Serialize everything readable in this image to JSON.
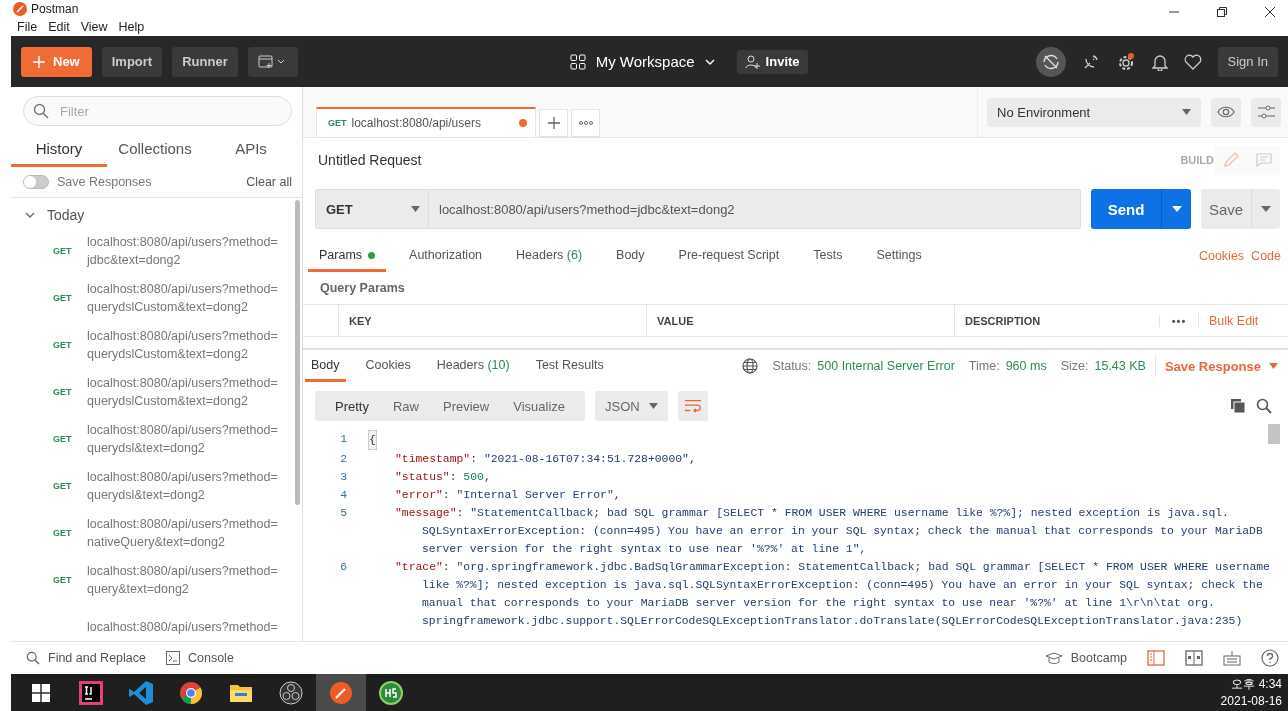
{
  "window": {
    "title": "Postman"
  },
  "menu": [
    "File",
    "Edit",
    "View",
    "Help"
  ],
  "toolbar": {
    "new": "New",
    "import": "Import",
    "runner": "Runner",
    "workspace": "My Workspace",
    "invite": "Invite",
    "sign_in": "Sign In",
    "sync_off": true,
    "settings_badge": true
  },
  "sidebar": {
    "filter_placeholder": "Filter",
    "tabs": [
      {
        "label": "History",
        "selected": true
      },
      {
        "label": "Collections",
        "selected": false
      },
      {
        "label": "APIs",
        "selected": false
      }
    ],
    "save_responses": {
      "label": "Save Responses",
      "on": false
    },
    "clear_all": "Clear all",
    "group": {
      "label": "Today",
      "expanded": true
    },
    "items": [
      {
        "method": "GET",
        "url": "localhost:8080/api/users?method=",
        "url2": "jdbc&text=dong2"
      },
      {
        "method": "GET",
        "url": "localhost:8080/api/users?method=",
        "url2": "querydslCustom&text=dong2"
      },
      {
        "method": "GET",
        "url": "localhost:8080/api/users?method=",
        "url2": "querydslCustom&text=dong2"
      },
      {
        "method": "GET",
        "url": "localhost:8080/api/users?method=",
        "url2": "querydslCustom&text=dong2"
      },
      {
        "method": "GET",
        "url": "localhost:8080/api/users?method=",
        "url2": "querydsl&text=dong2"
      },
      {
        "method": "GET",
        "url": "localhost:8080/api/users?method=",
        "url2": "querydsl&text=dong2"
      },
      {
        "method": "GET",
        "url": "localhost:8080/api/users?method=",
        "url2": "nativeQuery&text=dong2"
      },
      {
        "method": "GET",
        "url": "localhost:8080/api/users?method=",
        "url2": "query&text=dong2"
      },
      {
        "url": "localhost:8080/api/users?method="
      }
    ]
  },
  "request_tabs": [
    {
      "method": "GET",
      "label": "localhost:8080/api/users",
      "unsaved": true,
      "selected": true
    }
  ],
  "environment": "No Environment",
  "request": {
    "title": "Untitled Request",
    "mode": "BUILD",
    "method": "GET",
    "url": "localhost:8080/api/users?method=jdbc&text=dong2",
    "send": "Send",
    "save": "Save"
  },
  "request_sections": [
    {
      "label": "Params",
      "selected": true,
      "dot": true
    },
    {
      "label": "Authorization",
      "selected": false
    },
    {
      "label": "Headers",
      "count": "(6)",
      "selected": false
    },
    {
      "label": "Body",
      "selected": false
    },
    {
      "label": "Pre-request Script",
      "selected": false
    },
    {
      "label": "Tests",
      "selected": false
    },
    {
      "label": "Settings",
      "selected": false
    }
  ],
  "request_links": [
    "Cookies",
    "Code"
  ],
  "query_params": {
    "title": "Query Params",
    "columns": [
      "KEY",
      "VALUE",
      "DESCRIPTION"
    ],
    "more": "•••",
    "bulk_edit": "Bulk Edit"
  },
  "response_tabs": [
    {
      "label": "Body",
      "selected": true
    },
    {
      "label": "Cookies",
      "selected": false
    },
    {
      "label": "Headers",
      "count": "(10)",
      "selected": false
    },
    {
      "label": "Test Results",
      "selected": false
    }
  ],
  "response_meta": {
    "status_label": "Status:",
    "status": "500 Internal Server Error",
    "time_label": "Time:",
    "time": "960 ms",
    "size_label": "Size:",
    "size": "15.43 KB",
    "save_response": "Save Response"
  },
  "view_modes": [
    {
      "label": "Pretty",
      "selected": true
    },
    {
      "label": "Raw",
      "selected": false
    },
    {
      "label": "Preview",
      "selected": false
    },
    {
      "label": "Visualize",
      "selected": false
    }
  ],
  "format": "JSON",
  "wrap_on": true,
  "code": [
    {
      "num": "1",
      "parts": [
        {
          "kind": "punct",
          "text": "{"
        }
      ]
    },
    {
      "num": "2",
      "parts": [
        {
          "kind": "key",
          "text": "\"timestamp\""
        },
        {
          "kind": "punct",
          "text": ": "
        },
        {
          "kind": "string",
          "text": "\"2021-08-16T07:34:51.728+0000\""
        },
        {
          "kind": "punct",
          "text": ","
        }
      ]
    },
    {
      "num": "3",
      "parts": [
        {
          "kind": "key",
          "text": "\"status\""
        },
        {
          "kind": "punct",
          "text": ": "
        },
        {
          "kind": "number",
          "text": "500"
        },
        {
          "kind": "punct",
          "text": ","
        }
      ]
    },
    {
      "num": "4",
      "parts": [
        {
          "kind": "key",
          "text": "\"error\""
        },
        {
          "kind": "punct",
          "text": ": "
        },
        {
          "kind": "string",
          "text": "\"Internal Server Error\""
        },
        {
          "kind": "punct",
          "text": ","
        }
      ]
    },
    {
      "num": "5",
      "parts": [
        {
          "kind": "key",
          "text": "\"message\""
        },
        {
          "kind": "punct",
          "text": ": "
        },
        {
          "kind": "string",
          "text": "\"StatementCallback; bad SQL grammar [SELECT * FROM USER WHERE username like %?%]; nested exception is java.sql."
        }
      ],
      "more": [
        "SQLSyntaxErrorException: (conn=495) You have an error in your SQL syntax; check the manual that corresponds to your MariaDB",
        "server version for the right syntax to use near '%?%' at line 1\","
      ]
    },
    {
      "num": "6",
      "parts": [
        {
          "kind": "key",
          "text": "\"trace\""
        },
        {
          "kind": "punct",
          "text": ": "
        },
        {
          "kind": "string",
          "text": "\"org.springframework.jdbc.BadSqlGrammarException: StatementCallback; bad SQL grammar [SELECT * FROM USER WHERE username"
        }
      ],
      "more": [
        "like %?%]; nested exception is java.sql.SQLSyntaxErrorException: (conn=495) You have an error in your SQL syntax; check the",
        "manual that corresponds to your MariaDB server version for the right syntax to use near '%?%' at line 1\\r\\n\\tat org.",
        "springframework.jdbc.support.SQLErrorCodeSQLExceptionTranslator.doTranslate(SQLErrorCodeSQLExceptionTranslator.java:235)"
      ]
    }
  ],
  "status_bar": {
    "find": "Find and Replace",
    "console": "Console",
    "bootcamp": "Bootcamp"
  },
  "taskbar": {
    "apps": [
      {
        "kind": "windows",
        "selected": false
      },
      {
        "kind": "intellij",
        "selected": false
      },
      {
        "kind": "vscode",
        "selected": false
      },
      {
        "kind": "chrome",
        "selected": false
      },
      {
        "kind": "explorer",
        "selected": false
      },
      {
        "kind": "obs",
        "selected": false
      },
      {
        "kind": "postman",
        "selected": true
      },
      {
        "kind": "hs",
        "selected": false
      }
    ],
    "time": "오후 4:34",
    "date": "2021-08-16"
  }
}
